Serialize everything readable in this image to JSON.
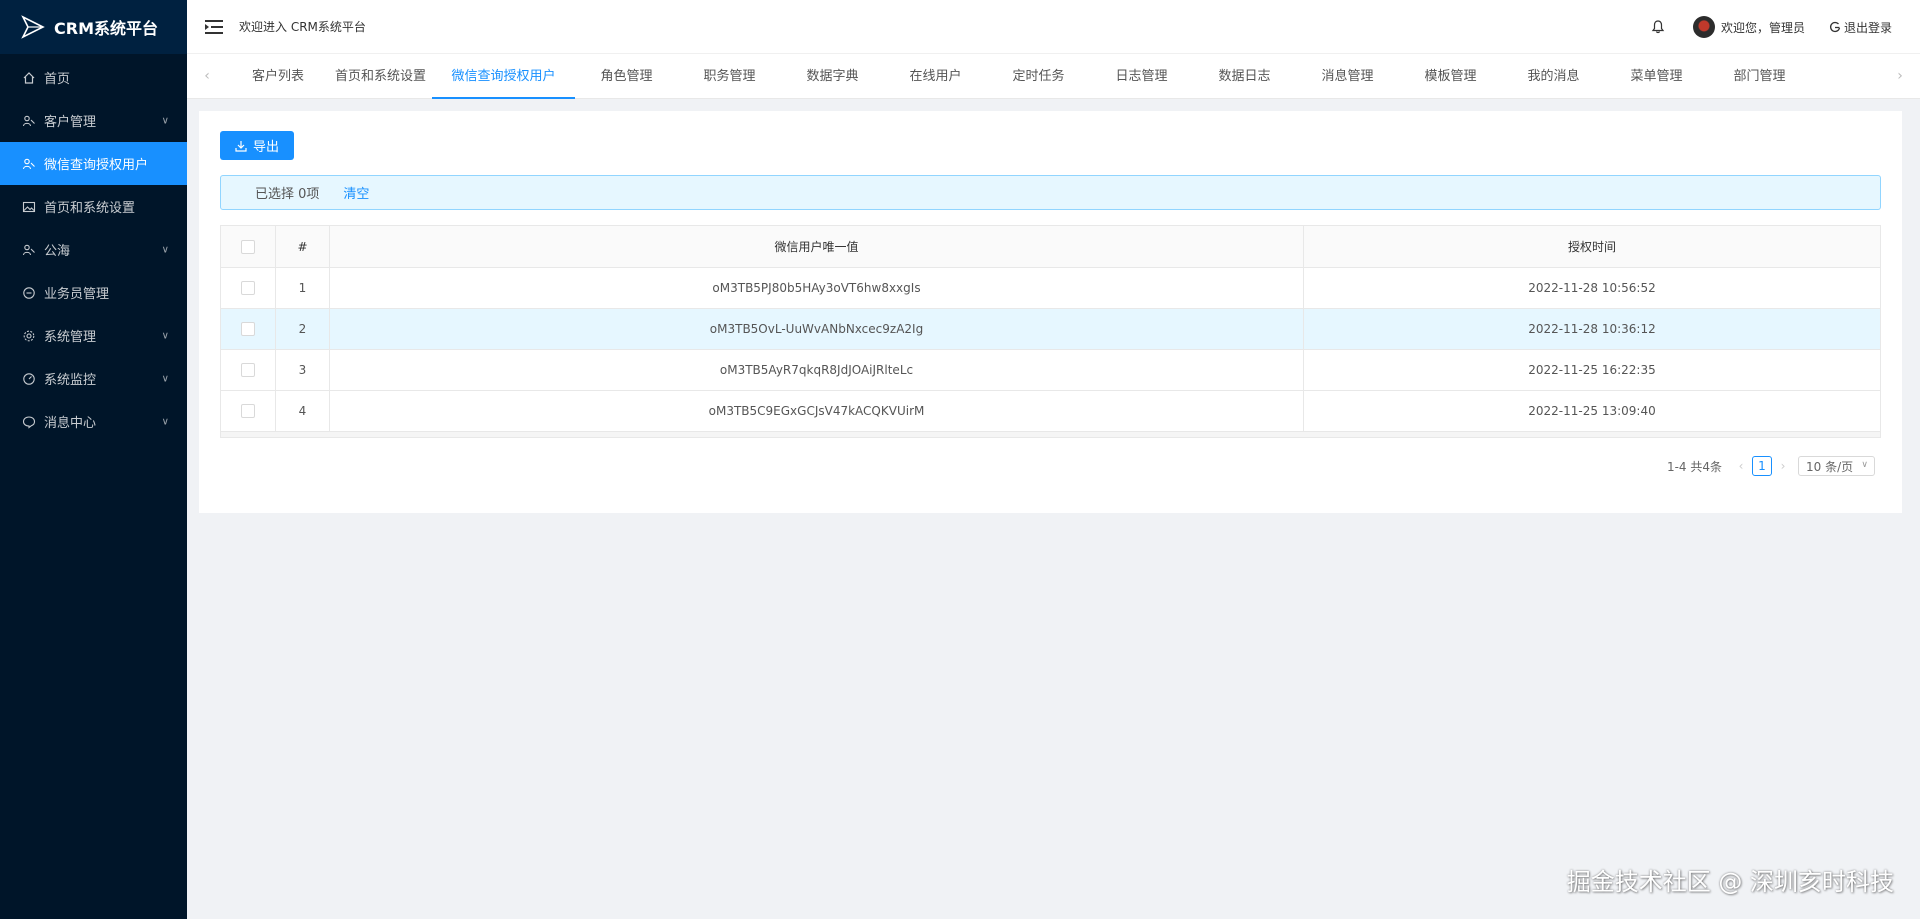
{
  "app": {
    "title": "CRM系统平台"
  },
  "sidebar": {
    "items": [
      {
        "label": "首页",
        "icon": "home-icon",
        "has_children": false,
        "active": false
      },
      {
        "label": "客户管理",
        "icon": "users-icon",
        "has_children": true,
        "active": false
      },
      {
        "label": "微信查询授权用户",
        "icon": "user-auth-icon",
        "has_children": false,
        "active": true
      },
      {
        "label": "首页和系统设置",
        "icon": "image-icon",
        "has_children": false,
        "active": false
      },
      {
        "label": "公海",
        "icon": "users-icon",
        "has_children": true,
        "active": false
      },
      {
        "label": "业务员管理",
        "icon": "clock-icon",
        "has_children": false,
        "active": false
      },
      {
        "label": "系统管理",
        "icon": "gear-icon",
        "has_children": true,
        "active": false
      },
      {
        "label": "系统监控",
        "icon": "gauge-icon",
        "has_children": true,
        "active": false
      },
      {
        "label": "消息中心",
        "icon": "message-icon",
        "has_children": true,
        "active": false
      }
    ]
  },
  "header": {
    "welcome": "欢迎进入 CRM系统平台",
    "greeting": "欢迎您，管理员",
    "logout": "退出登录"
  },
  "tabs": {
    "items": [
      {
        "label": "客户列表",
        "active": false
      },
      {
        "label": "首页和系统设置",
        "active": false
      },
      {
        "label": "微信查询授权用户",
        "active": true
      },
      {
        "label": "角色管理",
        "active": false
      },
      {
        "label": "职务管理",
        "active": false
      },
      {
        "label": "数据字典",
        "active": false
      },
      {
        "label": "在线用户",
        "active": false
      },
      {
        "label": "定时任务",
        "active": false
      },
      {
        "label": "日志管理",
        "active": false
      },
      {
        "label": "数据日志",
        "active": false
      },
      {
        "label": "消息管理",
        "active": false
      },
      {
        "label": "模板管理",
        "active": false
      },
      {
        "label": "我的消息",
        "active": false
      },
      {
        "label": "菜单管理",
        "active": false
      },
      {
        "label": "部门管理",
        "active": false
      }
    ]
  },
  "toolbar": {
    "export_label": "导出"
  },
  "selection": {
    "selected_text": "已选择 0项",
    "clear_label": "清空"
  },
  "table": {
    "columns": [
      "#",
      "微信用户唯一值",
      "授权时间"
    ],
    "rows": [
      {
        "index": "1",
        "openid": "oM3TB5PJ80b5HAy3oVT6hw8xxgIs",
        "time": "2022-11-28 10:56:52",
        "highlighted": false
      },
      {
        "index": "2",
        "openid": "oM3TB5OvL-UuWvANbNxcec9zA2Ig",
        "time": "2022-11-28 10:36:12",
        "highlighted": true
      },
      {
        "index": "3",
        "openid": "oM3TB5AyR7qkqR8JdJOAiJRlteLc",
        "time": "2022-11-25 16:22:35",
        "highlighted": false
      },
      {
        "index": "4",
        "openid": "oM3TB5C9EGxGCJsV47kACQKVUirM",
        "time": "2022-11-25 13:09:40",
        "highlighted": false
      }
    ]
  },
  "pagination": {
    "total_text": "1-4 共4条",
    "current_page": "1",
    "page_size": "10 条/页"
  },
  "watermark": "掘金技术社区 @ 深圳亥时科技",
  "colors": {
    "primary": "#1890ff",
    "sidebar_bg": "#001529",
    "logo_bg": "#002140",
    "highlight_row": "#e6f7ff"
  }
}
